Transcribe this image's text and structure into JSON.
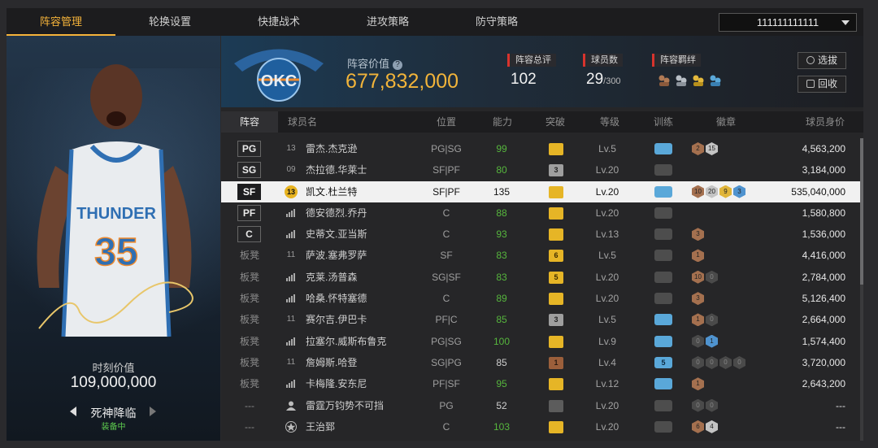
{
  "tabs": [
    "阵容管理",
    "轮换设置",
    "快捷战术",
    "进攻策略",
    "防守策略"
  ],
  "account": "111111111111",
  "card": {
    "value_label": "时刻价值",
    "value": "109,000,000",
    "skill": "死神降临",
    "skill_status": "装备中",
    "jersey_team": "THUNDER",
    "jersey_number": "35"
  },
  "summary": {
    "logo_text": "OKC",
    "lineup_value_label": "阵容价值",
    "lineup_value": "677,832,000",
    "rating_label": "阵容总评",
    "rating": "102",
    "count_label": "球员数",
    "count": "29",
    "count_max": "/300",
    "bond_label": "阵容羁绊",
    "select_button": "选拔",
    "recycle_button": "回收"
  },
  "columns": {
    "lineup": "阵容",
    "name": "球员名",
    "position": "位置",
    "ability": "能力",
    "breakthrough": "突破",
    "level": "等级",
    "training": "训练",
    "badges": "徽章",
    "price": "球员身价"
  },
  "colors": {
    "accent": "#f5b33a",
    "value_gold": "#f2b43a",
    "green": "#56b63d",
    "red_marker": "#d8332d"
  },
  "rows": [
    {
      "slot": "PG",
      "bench": false,
      "num": "13",
      "name": "雷杰.杰克逊",
      "pos": "PG|SG",
      "ability": "99",
      "green": true,
      "bk": "gold",
      "bk_text": "",
      "lvl": "Lv.5",
      "train": "blue",
      "train_text": "",
      "badges": [
        [
          "bronze",
          "2"
        ],
        [
          "silver",
          "15"
        ]
      ],
      "price": "4,563,200"
    },
    {
      "slot": "SG",
      "bench": false,
      "num": "09",
      "name": "杰拉德.华莱士",
      "pos": "SF|PF",
      "ability": "80",
      "green": true,
      "bk": "silver",
      "bk_text": "3",
      "lvl": "Lv.20",
      "train": "gray",
      "train_text": "",
      "badges": [],
      "price": "3,184,000"
    },
    {
      "slot": "SF",
      "bench": false,
      "sel": true,
      "num": "13",
      "circ": true,
      "name": "凯文.杜兰特",
      "pos": "SF|PF",
      "ability": "135",
      "green": false,
      "bk": "gold",
      "bk_text": "",
      "lvl": "Lv.20",
      "train": "blue",
      "train_text": "",
      "badges": [
        [
          "bronze",
          "10"
        ],
        [
          "silver",
          "20"
        ],
        [
          "gold",
          "9"
        ],
        [
          "blue",
          "3"
        ]
      ],
      "price": "535,040,000"
    },
    {
      "slot": "PF",
      "bench": false,
      "num": "",
      "bars": true,
      "name": "德安德烈.乔丹",
      "pos": "C",
      "ability": "88",
      "green": true,
      "bk": "gold",
      "bk_text": "",
      "lvl": "Lv.20",
      "train": "gray",
      "train_text": "",
      "badges": [],
      "price": "1,580,800"
    },
    {
      "slot": "C",
      "bench": false,
      "num": "",
      "bars": true,
      "name": "史蒂文.亚当斯",
      "pos": "C",
      "ability": "93",
      "green": true,
      "bk": "gold",
      "bk_text": "",
      "lvl": "Lv.13",
      "train": "gray",
      "train_text": "",
      "badges": [
        [
          "bronze",
          "3"
        ]
      ],
      "price": "1,536,000"
    },
    {
      "slot": "板凳",
      "bench": true,
      "num": "11",
      "name": "萨波.塞弗罗萨",
      "pos": "SF",
      "ability": "83",
      "green": true,
      "bk": "gold",
      "bk_text": "6",
      "lvl": "Lv.5",
      "train": "gray",
      "train_text": "",
      "badges": [
        [
          "bronze",
          "1"
        ]
      ],
      "price": "4,416,000"
    },
    {
      "slot": "板凳",
      "bench": true,
      "num": "",
      "bars": true,
      "name": "克莱.汤普森",
      "pos": "SG|SF",
      "ability": "83",
      "green": true,
      "bk": "gold",
      "bk_text": "5",
      "lvl": "Lv.20",
      "train": "gray",
      "train_text": "",
      "badges": [
        [
          "bronze",
          "10"
        ],
        [
          "dark",
          "0"
        ]
      ],
      "price": "2,784,000"
    },
    {
      "slot": "板凳",
      "bench": true,
      "num": "",
      "bars": true,
      "name": "哈桑.怀特塞德",
      "pos": "C",
      "ability": "89",
      "green": true,
      "bk": "gold",
      "bk_text": "",
      "lvl": "Lv.20",
      "train": "gray",
      "train_text": "",
      "badges": [
        [
          "bronze",
          "3"
        ]
      ],
      "price": "5,126,400"
    },
    {
      "slot": "板凳",
      "bench": true,
      "num": "11",
      "name": "赛尔吉.伊巴卡",
      "pos": "PF|C",
      "ability": "85",
      "green": true,
      "bk": "silver",
      "bk_text": "3",
      "lvl": "Lv.5",
      "train": "blue",
      "train_text": "",
      "badges": [
        [
          "bronze",
          "1"
        ],
        [
          "dark",
          "0"
        ]
      ],
      "price": "2,664,000"
    },
    {
      "slot": "板凳",
      "bench": true,
      "num": "",
      "bars": true,
      "name": "拉塞尔.威斯布鲁克",
      "pos": "PG|SG",
      "ability": "100",
      "green": true,
      "bk": "gold",
      "bk_text": "",
      "lvl": "Lv.9",
      "train": "blue",
      "train_text": "",
      "badges": [
        [
          "dark",
          "0"
        ],
        [
          "blue",
          "1"
        ]
      ],
      "price": "1,574,400"
    },
    {
      "slot": "板凳",
      "bench": true,
      "num": "11",
      "name": "詹姆斯.哈登",
      "pos": "SG|PG",
      "ability": "85",
      "green": false,
      "bk": "bronze",
      "bk_text": "1",
      "lvl": "Lv.4",
      "train": "blue",
      "train_text": "5",
      "badges": [
        [
          "dark",
          "0"
        ],
        [
          "dark",
          "0"
        ],
        [
          "dark",
          "0"
        ],
        [
          "dark",
          "0"
        ]
      ],
      "price": "3,720,000"
    },
    {
      "slot": "板凳",
      "bench": true,
      "num": "",
      "bars": true,
      "name": "卡梅隆.安东尼",
      "pos": "PF|SF",
      "ability": "95",
      "green": true,
      "bk": "gold",
      "bk_text": "",
      "lvl": "Lv.12",
      "train": "blue",
      "train_text": "",
      "badges": [
        [
          "bronze",
          "1"
        ]
      ],
      "price": "2,643,200"
    },
    {
      "slot": "---",
      "bench": true,
      "num": "",
      "person": true,
      "name": "雷霆万钧势不可挡",
      "pos": "PG",
      "ability": "52",
      "green": false,
      "bk": "gray",
      "bk_text": "",
      "lvl": "Lv.20",
      "train": "gray",
      "train_text": "",
      "badges": [
        [
          "dark",
          "0"
        ],
        [
          "dark",
          "0"
        ]
      ],
      "price": "---"
    },
    {
      "slot": "---",
      "bench": true,
      "num": "",
      "star": true,
      "name": "王治郅",
      "pos": "C",
      "ability": "103",
      "green": true,
      "bk": "gold",
      "bk_text": "",
      "lvl": "Lv.20",
      "train": "gray",
      "train_text": "",
      "badges": [
        [
          "bronze",
          "6"
        ],
        [
          "silver",
          "4"
        ]
      ],
      "price": "---"
    }
  ]
}
